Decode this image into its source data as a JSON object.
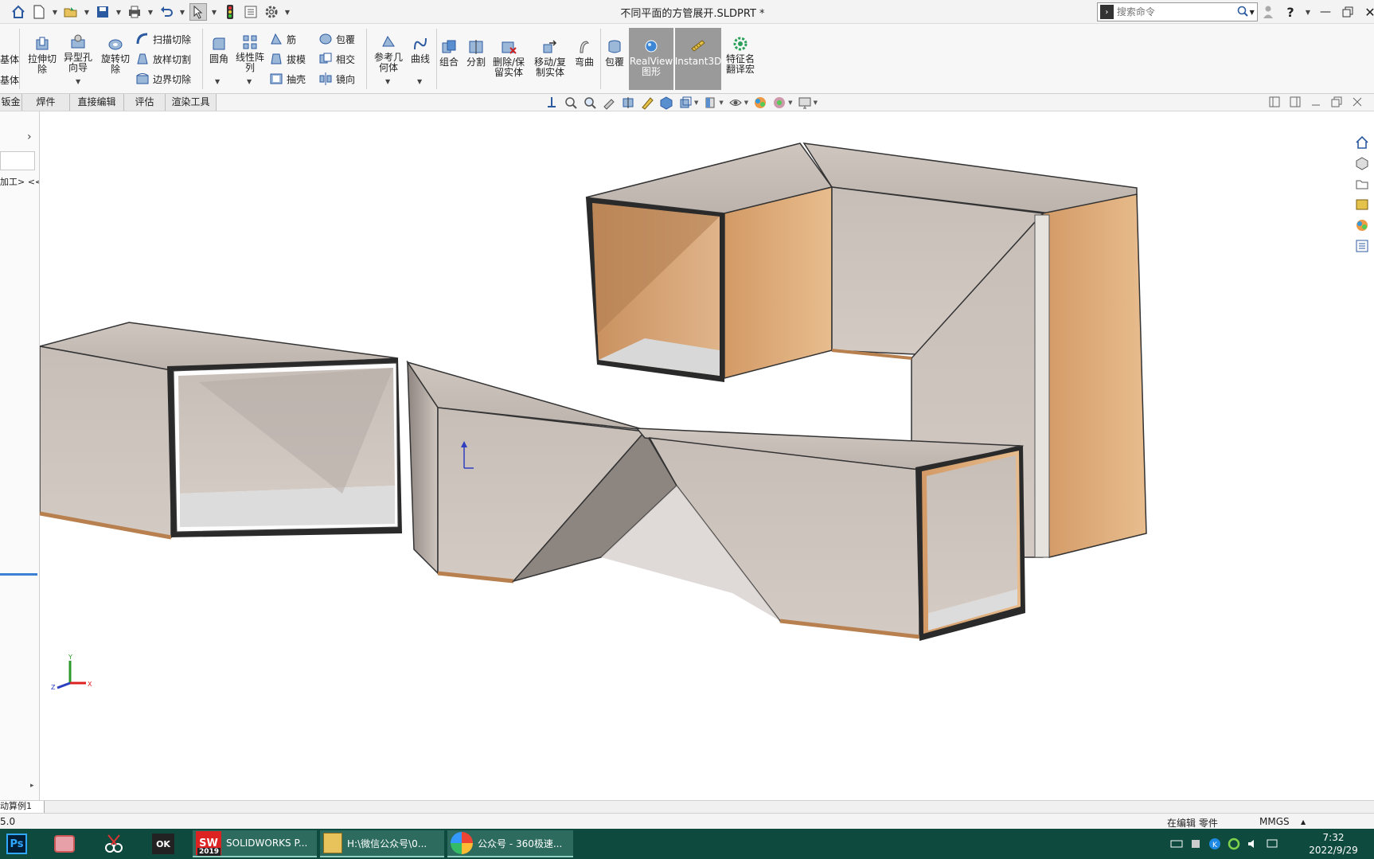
{
  "window": {
    "title": "不同平面的方管展开.SLDPRT *"
  },
  "search": {
    "placeholder": "搜索命令"
  },
  "ribbon": {
    "partial_left": [
      "基体",
      "基体"
    ],
    "extrude_cut": "拉伸切\n除",
    "hole_wizard": "异型孔\n向导",
    "revolve_cut": "旋转切\n除",
    "sweep_cut": "扫描切除",
    "loft_cut": "放样切割",
    "boundary_cut": "边界切除",
    "fillet": "圆角",
    "linear_pattern": "线性阵\n列",
    "rib": "筋",
    "draft": "拔模",
    "shell": "抽壳",
    "wrap": "包覆",
    "intersect": "相交",
    "mirror": "镜向",
    "ref_geometry": "参考几\n何体",
    "curves": "曲线",
    "combine": "组合",
    "split": "分割",
    "delete_keep_body": "删除/保\n留实体",
    "move_copy_body": "移动/复\n制实体",
    "flex": "弯曲",
    "wrap2": "包覆",
    "realview": "RealView\n图形",
    "instant3d": "Instant3D",
    "feature_translate": "特征名\n翻译宏"
  },
  "command_tabs": [
    "钣金",
    "焊件",
    "直接编辑",
    "评估",
    "渲染工具"
  ],
  "feature_manager": {
    "text": "加工> <<"
  },
  "model_tabs": [
    "动算例1"
  ],
  "statusbar": {
    "left": "5.0",
    "editing": "在编辑 零件",
    "units": "MMGS"
  },
  "taskbar": {
    "apps": [
      {
        "label": "SOLIDWORKS P...",
        "badge": "2019"
      },
      {
        "label": "H:\\微信公众号\\0..."
      },
      {
        "label": "公众号 - 360极速..."
      }
    ],
    "clock_time": "7:32",
    "clock_date": "2022/9/29"
  },
  "colors": {
    "ribbon_bg": "#f7f7f7",
    "taskbar": "#0e4a3e",
    "tube_outer": "#c9bfb9",
    "tube_inner": "#d7a878",
    "accent_blue": "#3b7fd4"
  },
  "icons": {
    "quick_access": [
      "home-icon",
      "new-file-icon",
      "open-icon",
      "save-icon",
      "print-icon",
      "undo-icon",
      "select-icon",
      "traffic-light-icon",
      "file-properties-icon",
      "options-gear-icon"
    ],
    "title_right": [
      "user-icon",
      "help-icon",
      "minimize-icon",
      "restore-icon",
      "close-icon"
    ],
    "task_pane": [
      "home-icon",
      "3d-parts-icon",
      "folder-icon",
      "view-palette-icon",
      "appearance-icon",
      "custom-properties-icon"
    ]
  }
}
